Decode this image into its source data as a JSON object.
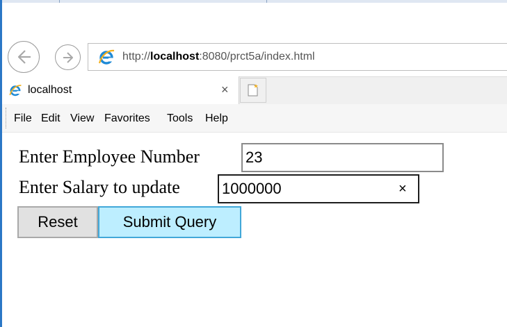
{
  "browser": {
    "address": {
      "prefix": "http://",
      "host": "localhost",
      "suffix": ":8080/prct5a/index.html"
    },
    "tab": {
      "title": "localhost",
      "close_glyph": "×"
    },
    "menu": [
      "File",
      "Edit",
      "View",
      "Favorites",
      "Tools",
      "Help"
    ],
    "icons": {
      "back": "back-arrow-icon",
      "forward": "forward-arrow-icon",
      "page": "ie-logo-icon",
      "new_tab": "new-tab-icon"
    },
    "colors": {
      "frame": "#2b77c6",
      "ie_logo": "#1f8ad6"
    }
  },
  "form": {
    "employee_label": "Enter Employee Number",
    "employee_value": "23",
    "salary_label": "Enter Salary to update",
    "salary_value": "1000000",
    "clear_glyph": "×",
    "reset_label": "Reset",
    "submit_label": "Submit Query",
    "colors": {
      "submit_bg": "#bdeeff",
      "submit_border": "#41a7d8"
    }
  }
}
